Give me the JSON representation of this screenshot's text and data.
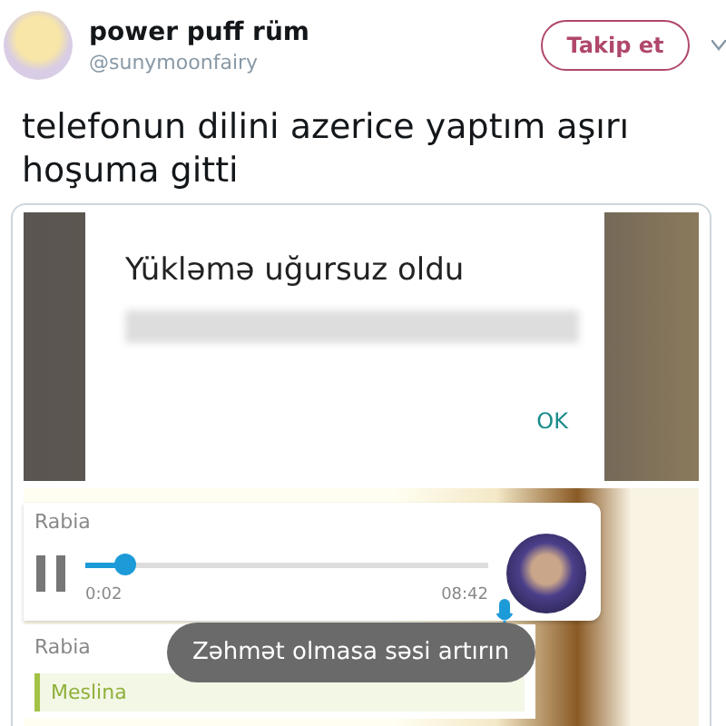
{
  "author": {
    "name": "power puff rüm",
    "handle": "@sunymoonfairy"
  },
  "follow_button": {
    "label": "Takip et"
  },
  "tweet_text": "telefonun dilini azerice yaptım aşırı hoşuma gitti",
  "dialog": {
    "title": "Yükləmə uğursuz oldu",
    "button": "OK"
  },
  "voice_message": {
    "sender": "Rabia",
    "level": 0.1,
    "elapsed": "0:02",
    "duration": "08:42"
  },
  "next_message": {
    "sender": "Rabia",
    "quote": "Meslina"
  },
  "toast": "Zəhmət olmasa səsi artırın"
}
